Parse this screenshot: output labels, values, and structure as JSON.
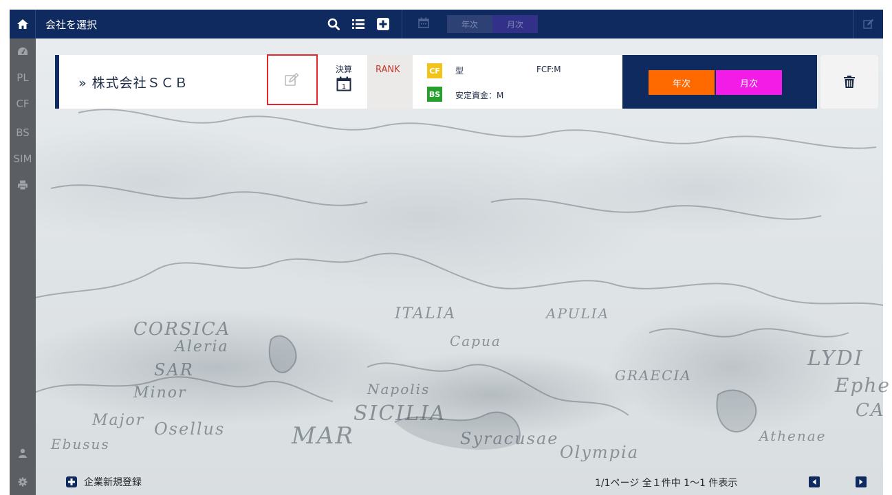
{
  "topbar": {
    "title": "会社を選択",
    "toggle_year": "年次",
    "toggle_month": "月次",
    "icons": [
      "home-icon",
      "search-icon",
      "list-icon",
      "add-icon",
      "calendar-icon",
      "edit-icon"
    ]
  },
  "sidebar": {
    "items": [
      {
        "label": "",
        "icon": "dashboard-icon"
      },
      {
        "label": "PL"
      },
      {
        "label": "CF"
      },
      {
        "label": "BS"
      },
      {
        "label": "SIM"
      },
      {
        "label": "",
        "icon": "print-icon"
      }
    ],
    "bottom_icons": [
      "user-icon",
      "gear-icon"
    ]
  },
  "company": {
    "name": "» 株式会社ＳＣＢ",
    "kessan_label": "決算",
    "kessan_month": "1",
    "rank_label": "RANK",
    "cf_tag": "CF",
    "bs_tag": "BS",
    "type_label": "型",
    "fcf_label": "FCF:M",
    "stable_funds_label": "安定資金：M",
    "year_button": "年次",
    "month_button": "月次"
  },
  "footer": {
    "add_company_label": "企業新規登録",
    "pager_text": "1/1ページ  全１件中 1～1 件表示"
  },
  "map_words": [
    "CORSICA",
    "Aleria",
    "SAR",
    "Minor",
    "Major",
    "Osellus",
    "MAR",
    "SICILIA",
    "Napolis",
    "Syracusae",
    "Olympia",
    "GRAECIA",
    "LYDI",
    "Ephe",
    "CA",
    "Athenae",
    "Capua",
    "ITALIA",
    "APULIA",
    "Ebusus"
  ],
  "colors": {
    "navy": "#0f2a5e",
    "sidebar": "#5b5e63",
    "year_orange": "#ff6a00",
    "month_magenta": "#f21ce6",
    "cf_yellow": "#f2c31a",
    "bs_green": "#27a02b",
    "highlight_red": "#e3262b"
  }
}
